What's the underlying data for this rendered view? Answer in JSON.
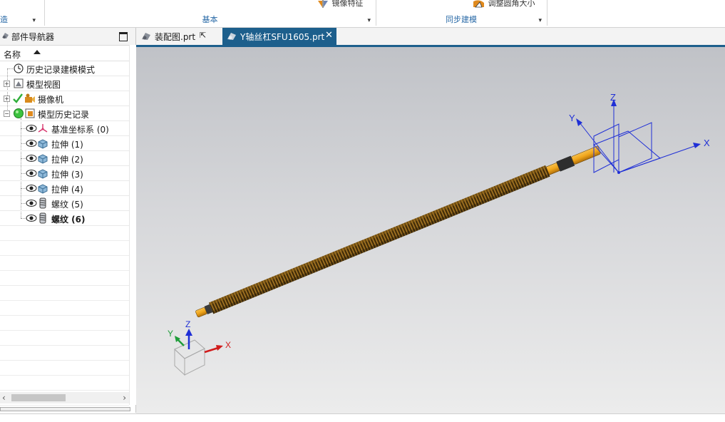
{
  "ribbon": {
    "left_fragment": "造",
    "group1_label": "基本",
    "group2_label": "同步建模",
    "btn_mirror": "镜像特征",
    "btn_resize": "调整圆角大小"
  },
  "navigator": {
    "title": "部件导航器",
    "column_name": "名称",
    "items": [
      {
        "label": "历史记录建模模式",
        "icon": "clock-icon"
      },
      {
        "label": "模型视图",
        "icon": "model-view-icon"
      },
      {
        "label": "摄像机",
        "icon": "camera-icon"
      },
      {
        "label": "模型历史记录",
        "icon": "history-icon"
      },
      {
        "label": "基准坐标系 (0)",
        "icon": "datum-csys-icon"
      },
      {
        "label": "拉伸 (1)",
        "icon": "extrude-icon"
      },
      {
        "label": "拉伸 (2)",
        "icon": "extrude-icon"
      },
      {
        "label": "拉伸 (3)",
        "icon": "extrude-icon"
      },
      {
        "label": "拉伸 (4)",
        "icon": "extrude-icon"
      },
      {
        "label": "螺纹 (5)",
        "icon": "thread-icon"
      },
      {
        "label": "螺纹 (6)",
        "icon": "thread-icon"
      }
    ]
  },
  "tabs": [
    {
      "label": "装配图.prt",
      "active": false
    },
    {
      "label": "Y轴丝杠SFU1605.prt",
      "active": true
    }
  ],
  "viewport": {
    "csys_big": {
      "x": "X",
      "y": "Y",
      "z": "Z"
    },
    "triad": {
      "x": "X",
      "y": "Y",
      "z": "Z"
    }
  },
  "colors": {
    "accent": "#1d5f8c",
    "screw_body": "#6b4a12",
    "screw_end": "#f2a71b",
    "csys_blue": "#1f2fd6",
    "axis_x_red": "#d11c1c",
    "axis_y_green": "#1f9d3a"
  }
}
